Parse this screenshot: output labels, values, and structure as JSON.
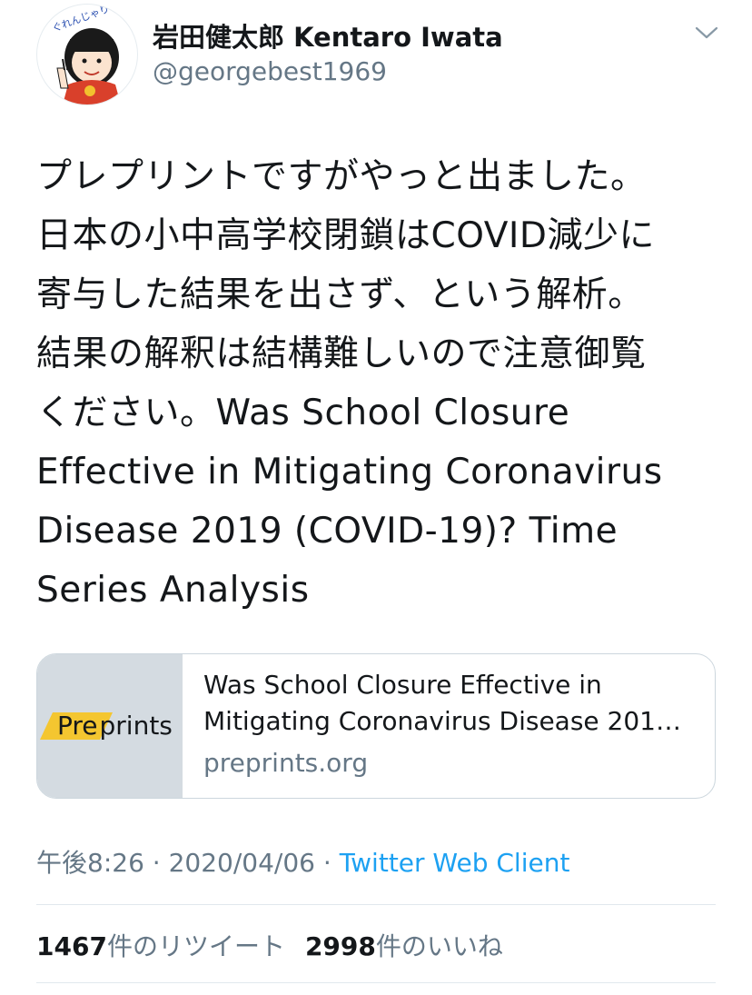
{
  "author": {
    "display_name": "岩田健太郎 Kentaro Iwata",
    "handle": "@georgebest1969",
    "avatar_icon": "cartoon-girl-avatar",
    "avatar_text": "ぐれんじゃり"
  },
  "tweet": {
    "lines": [
      "プレプリントですがやっと出ました。",
      "日本の小中高学校閉鎖はCOVID減少に",
      "寄与した結果を出さず、という解析。",
      "結果の解釈は結構難しいので注意御覧",
      "ください。Was School Closure",
      "Effective in Mitigating Coronavirus",
      "Disease 2019 (COVID-19)? Time",
      "Series Analysis"
    ]
  },
  "link_card": {
    "logo_pre": "Pre",
    "logo_rest": "prints",
    "title_line1": "Was School Closure Effective in",
    "title_line2": "Mitigating Coronavirus Disease 201…",
    "domain": "preprints.org"
  },
  "meta": {
    "time": "午後8:26",
    "sep1": " · ",
    "date": "2020/04/06",
    "sep2": " · ",
    "client": "Twitter Web Client"
  },
  "stats": {
    "retweets_count": "1467",
    "retweets_label": "件のリツイート",
    "likes_count": "2998",
    "likes_label": "件のいいね"
  },
  "colors": {
    "text": "#14171a",
    "secondary": "#657786",
    "link": "#1da1f2",
    "border": "#ccd6dd",
    "logo_accent": "#f4c630"
  }
}
